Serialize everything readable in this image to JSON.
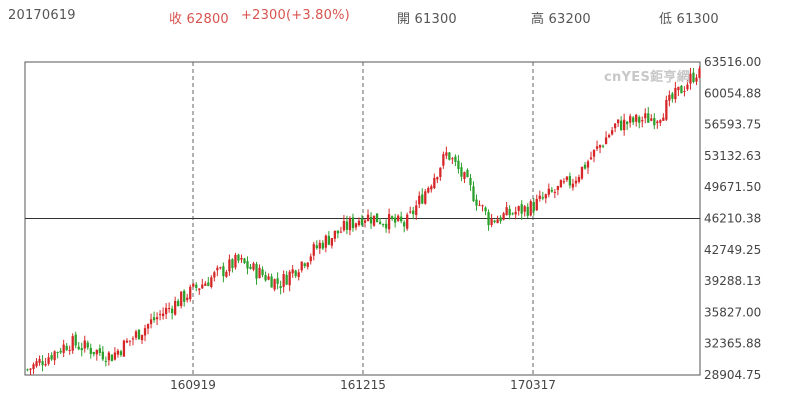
{
  "header": {
    "date": "20170619",
    "close_label": "收",
    "close_value": "62800",
    "change": "+2300(+3.80%)",
    "open_label": "開",
    "open_value": "61300",
    "high_label": "高",
    "high_value": "63200",
    "low_label": "低",
    "low_value": "61300"
  },
  "watermark": "cnYES鉅亨網",
  "colors": {
    "up": "#d62728",
    "down": "#2ca02c",
    "header_red": "#d9534f",
    "grid": "#666666",
    "frame": "#555555"
  },
  "chart_data": {
    "type": "candlestick",
    "title": "",
    "xlabel": "",
    "ylabel": "",
    "x_tick_labels": [
      "160919",
      "161215",
      "170317"
    ],
    "y_tick_labels": [
      "63516.00",
      "60054.88",
      "56593.75",
      "53132.63",
      "49671.50",
      "46210.38",
      "42749.25",
      "39288.13",
      "35827.00",
      "32365.88",
      "28904.75"
    ],
    "ylim": [
      28904.75,
      63516.0
    ],
    "reference_line": 46210.38,
    "grid": "vertical dashed at x ticks",
    "approx_close_path": [
      {
        "period": "start",
        "close": 29500
      },
      {
        "period": "early",
        "close": 32500
      },
      {
        "period": "early",
        "close": 31000
      },
      {
        "period": "mid",
        "close": 35000
      },
      {
        "period": "160919",
        "close": 38500
      },
      {
        "period": "after 160919",
        "close": 41500
      },
      {
        "period": "dip",
        "close": 39000
      },
      {
        "period": "rise",
        "close": 43500
      },
      {
        "period": "161215",
        "close": 46500
      },
      {
        "period": "flat",
        "close": 45500
      },
      {
        "period": "peak",
        "close": 53500
      },
      {
        "period": "dip",
        "close": 46000
      },
      {
        "period": "170317",
        "close": 47500
      },
      {
        "period": "rise",
        "close": 50500
      },
      {
        "period": "rise",
        "close": 56500
      },
      {
        "period": "rise",
        "close": 57500
      },
      {
        "period": "end",
        "close": 62800
      }
    ]
  }
}
